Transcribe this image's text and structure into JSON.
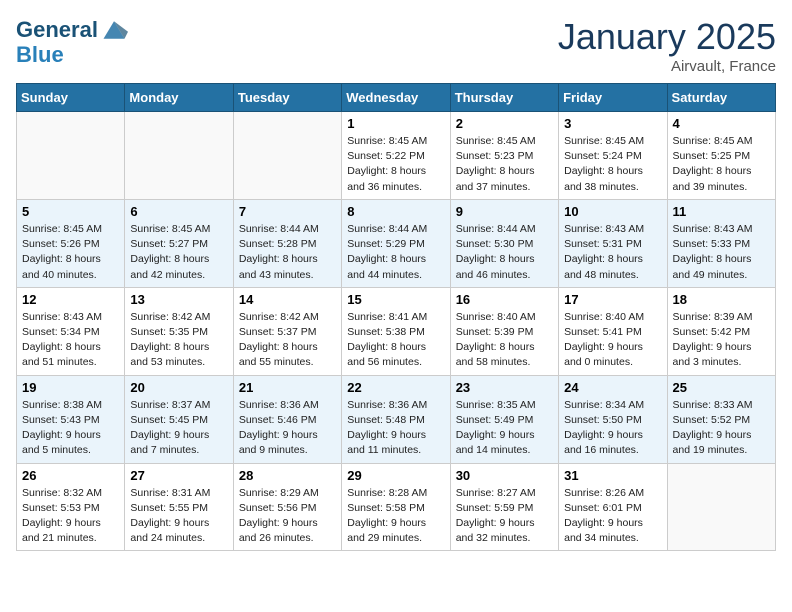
{
  "header": {
    "logo_main": "General",
    "logo_accent": "Blue",
    "month": "January 2025",
    "location": "Airvault, France"
  },
  "weekdays": [
    "Sunday",
    "Monday",
    "Tuesday",
    "Wednesday",
    "Thursday",
    "Friday",
    "Saturday"
  ],
  "weeks": [
    [
      {
        "day": "",
        "info": ""
      },
      {
        "day": "",
        "info": ""
      },
      {
        "day": "",
        "info": ""
      },
      {
        "day": "1",
        "info": "Sunrise: 8:45 AM\nSunset: 5:22 PM\nDaylight: 8 hours and 36 minutes."
      },
      {
        "day": "2",
        "info": "Sunrise: 8:45 AM\nSunset: 5:23 PM\nDaylight: 8 hours and 37 minutes."
      },
      {
        "day": "3",
        "info": "Sunrise: 8:45 AM\nSunset: 5:24 PM\nDaylight: 8 hours and 38 minutes."
      },
      {
        "day": "4",
        "info": "Sunrise: 8:45 AM\nSunset: 5:25 PM\nDaylight: 8 hours and 39 minutes."
      }
    ],
    [
      {
        "day": "5",
        "info": "Sunrise: 8:45 AM\nSunset: 5:26 PM\nDaylight: 8 hours and 40 minutes."
      },
      {
        "day": "6",
        "info": "Sunrise: 8:45 AM\nSunset: 5:27 PM\nDaylight: 8 hours and 42 minutes."
      },
      {
        "day": "7",
        "info": "Sunrise: 8:44 AM\nSunset: 5:28 PM\nDaylight: 8 hours and 43 minutes."
      },
      {
        "day": "8",
        "info": "Sunrise: 8:44 AM\nSunset: 5:29 PM\nDaylight: 8 hours and 44 minutes."
      },
      {
        "day": "9",
        "info": "Sunrise: 8:44 AM\nSunset: 5:30 PM\nDaylight: 8 hours and 46 minutes."
      },
      {
        "day": "10",
        "info": "Sunrise: 8:43 AM\nSunset: 5:31 PM\nDaylight: 8 hours and 48 minutes."
      },
      {
        "day": "11",
        "info": "Sunrise: 8:43 AM\nSunset: 5:33 PM\nDaylight: 8 hours and 49 minutes."
      }
    ],
    [
      {
        "day": "12",
        "info": "Sunrise: 8:43 AM\nSunset: 5:34 PM\nDaylight: 8 hours and 51 minutes."
      },
      {
        "day": "13",
        "info": "Sunrise: 8:42 AM\nSunset: 5:35 PM\nDaylight: 8 hours and 53 minutes."
      },
      {
        "day": "14",
        "info": "Sunrise: 8:42 AM\nSunset: 5:37 PM\nDaylight: 8 hours and 55 minutes."
      },
      {
        "day": "15",
        "info": "Sunrise: 8:41 AM\nSunset: 5:38 PM\nDaylight: 8 hours and 56 minutes."
      },
      {
        "day": "16",
        "info": "Sunrise: 8:40 AM\nSunset: 5:39 PM\nDaylight: 8 hours and 58 minutes."
      },
      {
        "day": "17",
        "info": "Sunrise: 8:40 AM\nSunset: 5:41 PM\nDaylight: 9 hours and 0 minutes."
      },
      {
        "day": "18",
        "info": "Sunrise: 8:39 AM\nSunset: 5:42 PM\nDaylight: 9 hours and 3 minutes."
      }
    ],
    [
      {
        "day": "19",
        "info": "Sunrise: 8:38 AM\nSunset: 5:43 PM\nDaylight: 9 hours and 5 minutes."
      },
      {
        "day": "20",
        "info": "Sunrise: 8:37 AM\nSunset: 5:45 PM\nDaylight: 9 hours and 7 minutes."
      },
      {
        "day": "21",
        "info": "Sunrise: 8:36 AM\nSunset: 5:46 PM\nDaylight: 9 hours and 9 minutes."
      },
      {
        "day": "22",
        "info": "Sunrise: 8:36 AM\nSunset: 5:48 PM\nDaylight: 9 hours and 11 minutes."
      },
      {
        "day": "23",
        "info": "Sunrise: 8:35 AM\nSunset: 5:49 PM\nDaylight: 9 hours and 14 minutes."
      },
      {
        "day": "24",
        "info": "Sunrise: 8:34 AM\nSunset: 5:50 PM\nDaylight: 9 hours and 16 minutes."
      },
      {
        "day": "25",
        "info": "Sunrise: 8:33 AM\nSunset: 5:52 PM\nDaylight: 9 hours and 19 minutes."
      }
    ],
    [
      {
        "day": "26",
        "info": "Sunrise: 8:32 AM\nSunset: 5:53 PM\nDaylight: 9 hours and 21 minutes."
      },
      {
        "day": "27",
        "info": "Sunrise: 8:31 AM\nSunset: 5:55 PM\nDaylight: 9 hours and 24 minutes."
      },
      {
        "day": "28",
        "info": "Sunrise: 8:29 AM\nSunset: 5:56 PM\nDaylight: 9 hours and 26 minutes."
      },
      {
        "day": "29",
        "info": "Sunrise: 8:28 AM\nSunset: 5:58 PM\nDaylight: 9 hours and 29 minutes."
      },
      {
        "day": "30",
        "info": "Sunrise: 8:27 AM\nSunset: 5:59 PM\nDaylight: 9 hours and 32 minutes."
      },
      {
        "day": "31",
        "info": "Sunrise: 8:26 AM\nSunset: 6:01 PM\nDaylight: 9 hours and 34 minutes."
      },
      {
        "day": "",
        "info": ""
      }
    ]
  ]
}
